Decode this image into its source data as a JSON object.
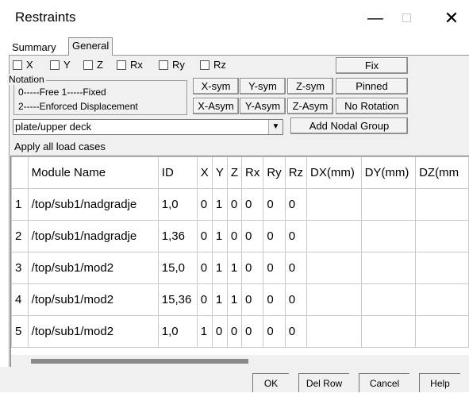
{
  "window": {
    "title": "Restraints",
    "min_glyph": "—",
    "close_glyph": "✕"
  },
  "tabs": {
    "summary": "Summary",
    "general": "General"
  },
  "checkboxes": [
    "X",
    "Y",
    "Z",
    "Rx",
    "Ry",
    "Rz"
  ],
  "buttons": {
    "fix": "Fix",
    "pinned": "Pinned",
    "no_rotation": "No Rotation",
    "add_nodal_group": "Add Nodal Group",
    "x_sym": "X-sym",
    "y_sym": "Y-sym",
    "z_sym": "Z-sym",
    "x_asym": "X-Asym",
    "y_asym": "Y-Asym",
    "z_asym": "Z-Asym"
  },
  "notation": {
    "legend": "Notation",
    "line1": "0-----Free      1-----Fixed",
    "line2": "2-----Enforced Displacement"
  },
  "group_select": {
    "value": "plate/upper deck"
  },
  "apply_all": "Apply all load cases",
  "table": {
    "headers": [
      "",
      "Module Name",
      "ID",
      "X",
      "Y",
      "Z",
      "Rx",
      "Ry",
      "Rz",
      "DX(mm)",
      "DY(mm)",
      "DZ(mm"
    ],
    "rows": [
      [
        "1",
        "/top/sub1/nadgradje",
        "1,0",
        "0",
        "1",
        "0",
        "0",
        "0",
        "0",
        "",
        "",
        ""
      ],
      [
        "2",
        "/top/sub1/nadgradje",
        "1,36",
        "0",
        "1",
        "0",
        "0",
        "0",
        "0",
        "",
        "",
        ""
      ],
      [
        "3",
        "/top/sub1/mod2",
        "15,0",
        "0",
        "1",
        "1",
        "0",
        "0",
        "0",
        "",
        "",
        ""
      ],
      [
        "4",
        "/top/sub1/mod2",
        "15,36",
        "0",
        "1",
        "1",
        "0",
        "0",
        "0",
        "",
        "",
        ""
      ],
      [
        "5",
        "/top/sub1/mod2",
        "1,0",
        "1",
        "0",
        "0",
        "0",
        "0",
        "0",
        "",
        "",
        ""
      ]
    ]
  },
  "footer": {
    "ok": "OK",
    "del_row": "Del Row",
    "cancel": "Cancel",
    "help": "Help"
  }
}
